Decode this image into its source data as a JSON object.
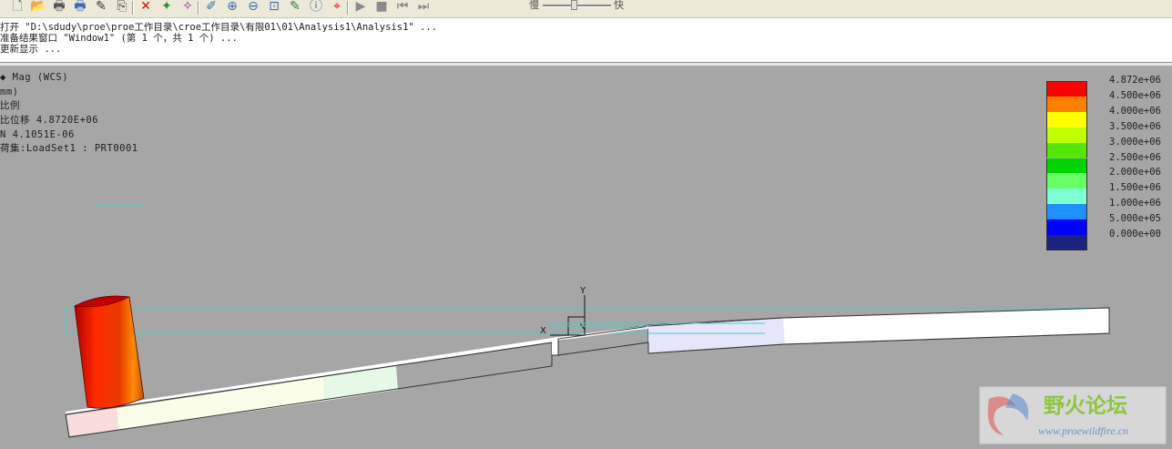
{
  "toolbar": {
    "buttons": [
      {
        "name": "new-icon",
        "glyph": "🗋",
        "color": "#3a6ab0"
      },
      {
        "name": "open-icon",
        "glyph": "📂",
        "color": "#3a6ab0"
      },
      {
        "name": "print-icon",
        "glyph": "🖶",
        "color": "#555"
      },
      {
        "name": "print-setup-icon",
        "glyph": "🖶",
        "color": "#3a6ab0"
      },
      {
        "name": "edit-definition-icon",
        "glyph": "✎",
        "color": "#333"
      },
      {
        "name": "copy-icon",
        "glyph": "⎘",
        "color": "#444"
      },
      {
        "name": "delete-icon",
        "glyph": "✕",
        "color": "#d01010"
      },
      {
        "name": "show-result-icon",
        "glyph": "✦",
        "color": "#2f8f2f"
      },
      {
        "name": "hide-result-icon",
        "glyph": "✧",
        "color": "#8f2f8f"
      },
      {
        "name": "edit-view-icon",
        "glyph": "✐",
        "color": "#3a6ab0"
      },
      {
        "name": "zoom-in-icon",
        "glyph": "⊕",
        "color": "#3a6ab0"
      },
      {
        "name": "zoom-out-icon",
        "glyph": "⊖",
        "color": "#3a6ab0"
      },
      {
        "name": "zoom-fit-icon",
        "glyph": "⊡",
        "color": "#3a6ab0"
      },
      {
        "name": "query-icon",
        "glyph": "✎",
        "color": "#2f7f2f"
      },
      {
        "name": "info-icon",
        "glyph": "ⓘ",
        "color": "#3a6ab0"
      },
      {
        "name": "probe-icon",
        "glyph": "⌖",
        "color": "#d01010"
      },
      {
        "name": "play-icon",
        "glyph": "▶",
        "color": "#8a8a8a"
      },
      {
        "name": "stop-icon",
        "glyph": "■",
        "color": "#8a8a8a"
      },
      {
        "name": "step-back-icon",
        "glyph": "⏮",
        "color": "#8a8a8a"
      },
      {
        "name": "step-forward-icon",
        "glyph": "⏭",
        "color": "#8a8a8a"
      }
    ],
    "slow_label": "慢",
    "fast_label": "快",
    "speed_value": 0.45
  },
  "messages": [
    "打开 \"D:\\sdudy\\proe\\proe工作目录\\croe工作目录\\有限01\\01\\Analysis1\\Analysis1\" ...",
    "准备结果窗口 \"Window1\" (第 1 个，共 1 个) ...",
    "更新显示 ..."
  ],
  "result_info": [
    "◆ Mag (WCS)",
    "mm)",
    "比例",
    "比位移  4.8720E+06",
    "N  4.1051E-06",
    "荷集:LoadSet1 :  PRT0001"
  ],
  "legend": {
    "labels": [
      "4.872e+06",
      "4.500e+06",
      "4.000e+06",
      "3.500e+06",
      "3.000e+06",
      "2.500e+06",
      "2.000e+06",
      "1.500e+06",
      "1.000e+06",
      "5.000e+05",
      "0.000e+00"
    ],
    "colors": [
      "#ff0000",
      "#ff7f00",
      "#ffff00",
      "#bfff00",
      "#55e600",
      "#00d400",
      "#66ff66",
      "#7fffd4",
      "#1e90ff",
      "#0000ff",
      "#1a237e"
    ]
  },
  "axes": {
    "x_label": "X",
    "y_label": "Y"
  },
  "watermark": {
    "brand": "野火论坛",
    "url": "www.proewildfire.cn"
  }
}
